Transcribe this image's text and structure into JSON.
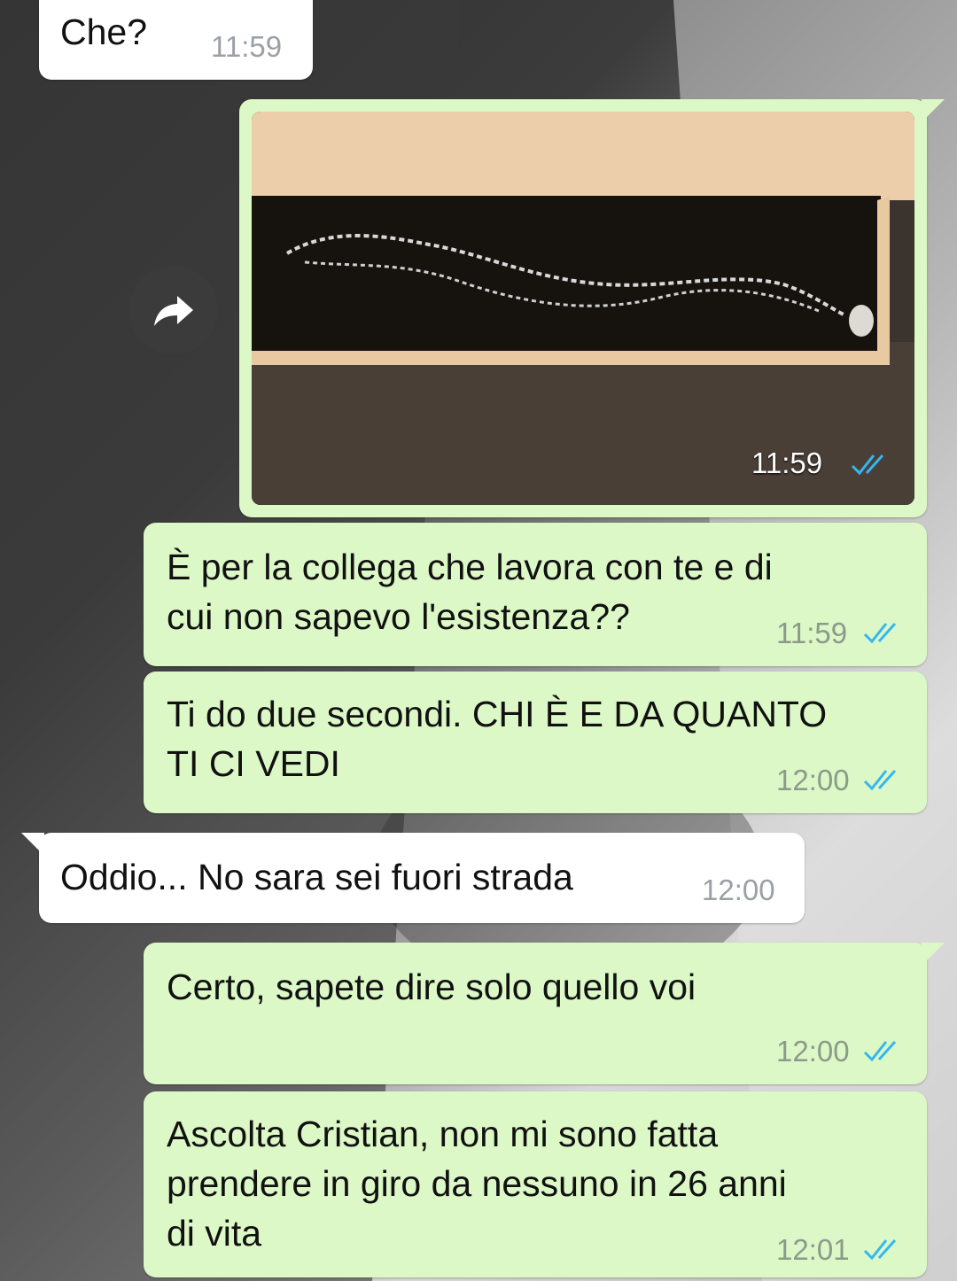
{
  "messages": [
    {
      "id": "m1",
      "direction": "in",
      "text": "Che?",
      "time": "11:59"
    },
    {
      "id": "m2",
      "direction": "out",
      "type": "image",
      "image_desc_icon": "necklace-photo",
      "time": "11:59",
      "status": "read"
    },
    {
      "id": "m3",
      "direction": "out",
      "text": "È per la collega che lavora con te e di cui non sapevo l'esistenza??",
      "line1": "È per la collega che lavora con te e di",
      "line2": "cui non sapevo l'esistenza??",
      "time": "11:59",
      "status": "read"
    },
    {
      "id": "m4",
      "direction": "out",
      "line1": "Ti do due secondi. CHI È E DA QUANTO",
      "line2": "TI CI VEDI",
      "time": "12:00",
      "status": "read"
    },
    {
      "id": "m5",
      "direction": "in",
      "text": "Oddio... No sara sei fuori strada",
      "time": "12:00"
    },
    {
      "id": "m6",
      "direction": "out",
      "text": "Certo, sapete dire solo quello voi",
      "time": "12:00",
      "status": "read"
    },
    {
      "id": "m7",
      "direction": "out",
      "line1": "Ascolta Cristian, non mi sono fatta",
      "line2": "prendere in giro da nessuno in 26 anni",
      "line3": "di vita",
      "time": "12:01",
      "status": "read"
    }
  ],
  "colors": {
    "outgoing": "#dcf8c6",
    "incoming": "#ffffff",
    "read_ticks": "#34b7f1"
  },
  "icons": {
    "forward": "forward-arrow-icon",
    "read_status": "double-check-icon"
  }
}
